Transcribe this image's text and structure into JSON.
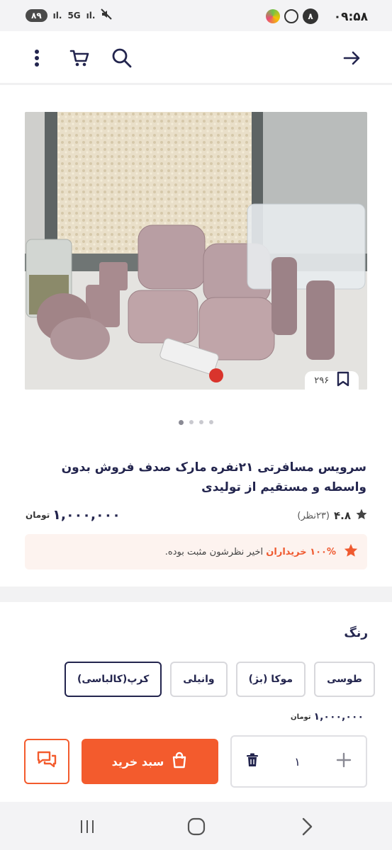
{
  "status_bar": {
    "battery": "۸۹",
    "network": "5G",
    "time": "۰۹:۵۸",
    "notification_count": "۸"
  },
  "product": {
    "bookmark_count": "۲۹۶",
    "title": "سرویس مسافرتی  ۲۱نفره مارک صدف فروش بدون واسطه و مستقیم از تولیدی",
    "rating_value": "۴.۸",
    "rating_count": "(۲۳نظر)",
    "price": "۱,۰۰۰,۰۰۰",
    "currency": "تومان",
    "slides_total": 4,
    "slide_active": 1
  },
  "trust": {
    "percent_text": "۱۰۰% خریداران",
    "rest_text": " اخیر نظرشون مثبت بوده."
  },
  "color_section": {
    "label": "رنگ",
    "options": [
      "طوسی",
      "موکا (بژ)",
      "وانیلی",
      "کرپ(کالباسی)"
    ],
    "selected": "کرپ(کالباسی)"
  },
  "purchase": {
    "price": "۱,۰۰۰,۰۰۰",
    "currency": "تومان",
    "quantity": "۱",
    "add_to_cart_label": "سبد خرید"
  },
  "colors": {
    "accent": "#f35b2d",
    "text_primary": "#23254e"
  }
}
